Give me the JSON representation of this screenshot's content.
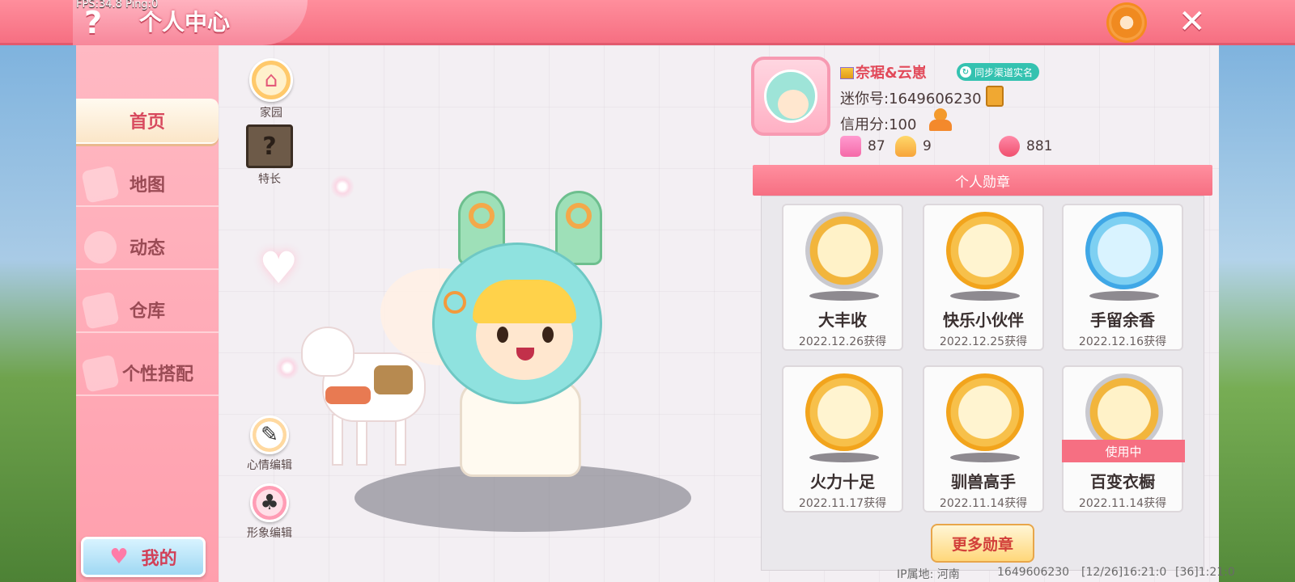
{
  "debug": {
    "fps_text": "FPS:34.8  Ping:0"
  },
  "header": {
    "title": "个人中心",
    "help_icon": "?",
    "settings_icon": "gear-icon",
    "close_icon": "✕"
  },
  "sidebar": {
    "items": [
      {
        "label": "首页",
        "active": true
      },
      {
        "label": "地图",
        "active": false
      },
      {
        "label": "动态",
        "active": false
      },
      {
        "label": "仓库",
        "active": false
      },
      {
        "label": "个性搭配",
        "active": false
      }
    ],
    "mine_label": "我的"
  },
  "shortcuts": {
    "home": "家园",
    "talent": "特长",
    "mood_edit": "心情编辑",
    "avatar_edit": "形象编辑"
  },
  "profile": {
    "nickname": "奈琚&云崽",
    "sync_badge": "同步渠道实名",
    "mini_id": "迷你号:1649606230",
    "credit": "信用分:100",
    "stats": [
      "87",
      "9",
      "881"
    ]
  },
  "medals": {
    "header": "个人勋章",
    "items": [
      {
        "name": "大丰收",
        "date": "2022.12.26获得",
        "style": "silver",
        "in_use": false
      },
      {
        "name": "快乐小伙伴",
        "date": "2022.12.25获得",
        "style": "gold",
        "in_use": false
      },
      {
        "name": "手留余香",
        "date": "2022.12.16获得",
        "style": "blue",
        "in_use": false
      },
      {
        "name": "火力十足",
        "date": "2022.11.17获得",
        "style": "gold",
        "in_use": false
      },
      {
        "name": "驯兽高手",
        "date": "2022.11.14获得",
        "style": "gold",
        "in_use": false
      },
      {
        "name": "百变衣橱",
        "date": "2022.11.14获得",
        "style": "silver",
        "in_use": true
      }
    ],
    "in_use_label": "使用中",
    "more_label": "更多勋章"
  },
  "footer": {
    "ip_label": "IP属地: 河南",
    "uid": "1649606230",
    "time_a": "[12/26]16:21:0",
    "time_b": "[36]1:21:0"
  },
  "colors": {
    "accent": "#f66f82",
    "highlight": "#d84a5e"
  }
}
